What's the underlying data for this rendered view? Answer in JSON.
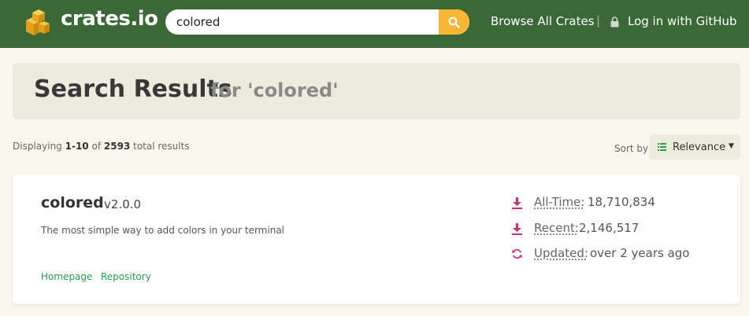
{
  "header": {
    "brand": "crates.io",
    "search_value": "colored",
    "browse_label": "Browse All Crates",
    "separator": "|",
    "login_label": "Log in with GitHub"
  },
  "results": {
    "title": "Search Results",
    "query_label": "for 'colored'",
    "displaying_prefix": "Displaying",
    "range": "1-10",
    "of": "of",
    "total": "2593",
    "total_suffix": "total results",
    "sort_label": "Sort by",
    "sort_value": "Relevance"
  },
  "crate": {
    "name": "colored",
    "version": "v2.0.0",
    "description": "The most simple way to add colors in your terminal",
    "links": [
      "Homepage",
      "Repository"
    ],
    "stats": {
      "all_time_label": "All-Time:",
      "all_time_value": "18,710,834",
      "recent_label": "Recent:",
      "recent_value": "2,146,517",
      "updated_label": "Updated:",
      "updated_value": "over 2 years ago"
    }
  },
  "colors": {
    "header_bg": "#3b6837",
    "search_button": "#f9b634",
    "link": "#2a9d4b",
    "stat_icon": "#c0337a",
    "page_bg": "#f9f7ec"
  },
  "icons": {
    "logo": "crate-cubes-icon",
    "search": "search-icon",
    "lock": "lock-icon",
    "sort": "list-icon",
    "download": "download-icon",
    "updated": "refresh-icon"
  }
}
